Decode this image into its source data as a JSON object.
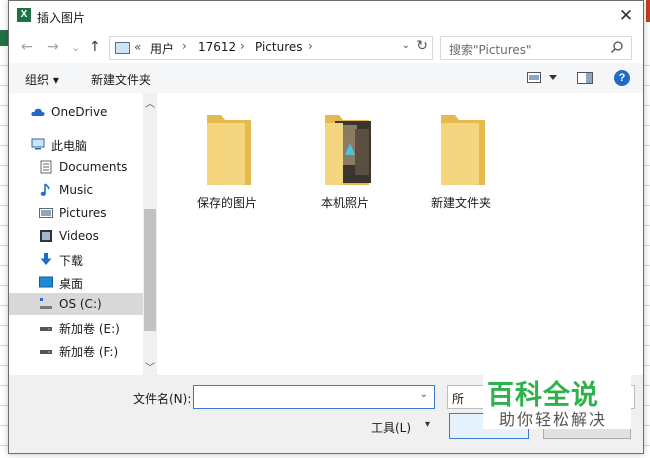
{
  "window": {
    "app_icon": "X",
    "title": "插入图片",
    "close_glyph": "✕"
  },
  "nav": {
    "back": "←",
    "forward": "→",
    "up": "↑",
    "recent": "⌄"
  },
  "address": {
    "prefix": "«",
    "crumbs": [
      "用户",
      "17612",
      "Pictures"
    ],
    "sep": "›",
    "dropdown": "⌄",
    "refresh": "↻"
  },
  "search": {
    "placeholder": "搜索\"Pictures\""
  },
  "toolbar": {
    "organize": "组织 ▾",
    "new_folder": "新建文件夹",
    "help": "?"
  },
  "sidebar": {
    "items": [
      {
        "label": "OneDrive",
        "icon": "cloud-icon"
      },
      {
        "label": "此电脑",
        "icon": "computer-icon"
      },
      {
        "label": "Documents",
        "icon": "documents-icon"
      },
      {
        "label": "Music",
        "icon": "music-icon"
      },
      {
        "label": "Pictures",
        "icon": "pictures-icon"
      },
      {
        "label": "Videos",
        "icon": "videos-icon"
      },
      {
        "label": "下载",
        "icon": "download-icon"
      },
      {
        "label": "桌面",
        "icon": "desktop-icon"
      },
      {
        "label": "OS (C:)",
        "icon": "drive-os-icon",
        "selected": true
      },
      {
        "label": "新加卷 (E:)",
        "icon": "drive-icon"
      },
      {
        "label": "新加卷 (F:)",
        "icon": "drive-icon"
      }
    ]
  },
  "folders": [
    {
      "label": "保存的图片"
    },
    {
      "label": "本机照片",
      "has_thumbnail": true
    },
    {
      "label": "新建文件夹"
    }
  ],
  "footer": {
    "filename_label": "文件名(N):",
    "filename_value": "",
    "filetype_value": "所",
    "tools_label": "工具(L)",
    "tools_dropdown": "▾"
  },
  "watermark": {
    "line1": "百科全说",
    "line2": "助你轻松解决"
  },
  "colors": {
    "folder": "#f3d27a",
    "accent": "#3d7bd1",
    "watermark_green": "#2fb24b"
  }
}
